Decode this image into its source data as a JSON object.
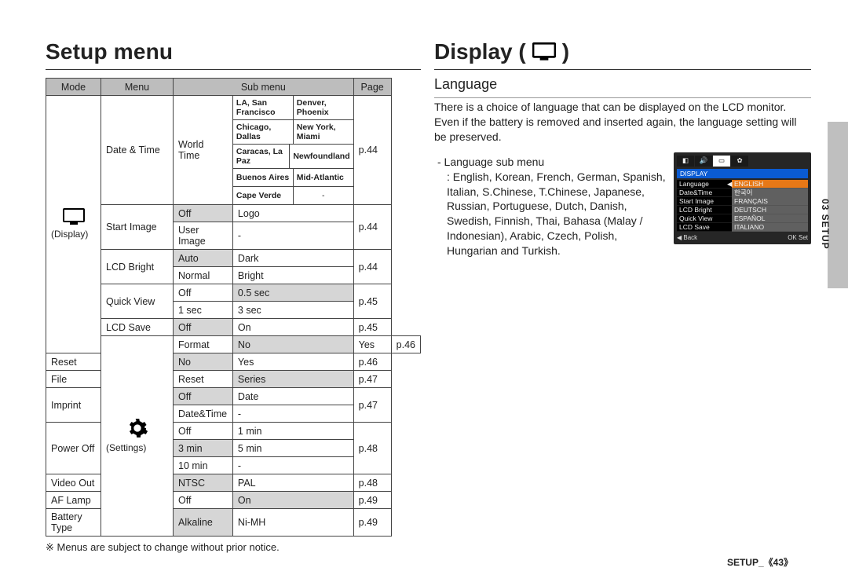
{
  "left": {
    "title": "Setup menu",
    "headers": {
      "mode": "Mode",
      "menu": "Menu",
      "submenu": "Sub menu",
      "page": "Page"
    },
    "display_label": "(Display)",
    "settings_label": "(Settings)",
    "footnote": "※ Menus are subject to change without prior notice.",
    "rows": {
      "datetime": {
        "menu": "Date & Time",
        "sub": "World Time",
        "page": "p.44",
        "cities": [
          [
            "LA, San Francisco",
            "Denver, Phoenix"
          ],
          [
            "Chicago, Dallas",
            "New York, Miami"
          ],
          [
            "Caracas, La Paz",
            "Newfoundland"
          ],
          [
            "Buenos Aires",
            "Mid-Atlantic"
          ],
          [
            "Cape Verde",
            "-"
          ]
        ]
      },
      "startimage": {
        "menu": "Start Image",
        "vals": [
          [
            "Off",
            "Logo"
          ],
          [
            "User Image",
            "-"
          ]
        ],
        "page": "p.44"
      },
      "lcdbright": {
        "menu": "LCD Bright",
        "vals": [
          [
            "Auto",
            "Dark"
          ],
          [
            "Normal",
            "Bright"
          ]
        ],
        "page": "p.44"
      },
      "quickview": {
        "menu": "Quick View",
        "vals": [
          [
            "Off",
            "0.5 sec"
          ],
          [
            "1 sec",
            "3 sec"
          ]
        ],
        "page": "p.45"
      },
      "lcdsave": {
        "menu": "LCD Save",
        "vals": [
          [
            "Off",
            "On"
          ]
        ],
        "page": "p.45"
      },
      "format": {
        "menu": "Format",
        "vals": [
          [
            "No",
            "Yes"
          ]
        ],
        "page": "p.46"
      },
      "reset": {
        "menu": "Reset",
        "vals": [
          [
            "No",
            "Yes"
          ]
        ],
        "page": "p.46"
      },
      "file": {
        "menu": "File",
        "vals": [
          [
            "Reset",
            "Series"
          ]
        ],
        "page": "p.47"
      },
      "imprint": {
        "menu": "Imprint",
        "vals": [
          [
            "Off",
            "Date"
          ],
          [
            "Date&Time",
            "-"
          ]
        ],
        "page": "p.47"
      },
      "poweroff": {
        "menu": "Power Off",
        "vals": [
          [
            "Off",
            "1 min"
          ],
          [
            "3 min",
            "5 min"
          ],
          [
            "10 min",
            "-"
          ]
        ],
        "page": "p.48"
      },
      "videoout": {
        "menu": "Video Out",
        "vals": [
          [
            "NTSC",
            "PAL"
          ]
        ],
        "page": "p.48"
      },
      "aflamp": {
        "menu": "AF Lamp",
        "vals": [
          [
            "Off",
            "On"
          ]
        ],
        "page": "p.49"
      },
      "battery": {
        "menu": "Battery Type",
        "vals": [
          [
            "Alkaline",
            "Ni-MH"
          ]
        ],
        "page": "p.49"
      }
    }
  },
  "right": {
    "title_prefix": "Display (",
    "title_suffix": " )",
    "section": "Language",
    "paragraph": "There is a choice of language that can be displayed on the LCD monitor. Even if the battery is removed and inserted again, the language setting will be preserved.",
    "bullet": "- Language sub menu",
    "bullet_body": ": English, Korean, French, German, Spanish, Italian, S.Chinese, T.Chinese, Japanese, Russian, Portuguese, Dutch, Danish, Swedish, Finnish, Thai, Bahasa (Malay / Indonesian), Arabic, Czech, Polish, Hungarian and Turkish."
  },
  "camera": {
    "header": "DISPLAY",
    "items": [
      {
        "label": "Language",
        "value": "ENGLISH"
      },
      {
        "label": "Date&Time",
        "value": "한국어"
      },
      {
        "label": "Start Image",
        "value": "FRANÇAIS"
      },
      {
        "label": "LCD Bright",
        "value": "DEUTSCH"
      },
      {
        "label": "Quick View",
        "value": "ESPAÑOL"
      },
      {
        "label": "LCD Save",
        "value": "ITALIANO"
      }
    ],
    "footer_back": "◀  Back",
    "footer_set": "OK  Set"
  },
  "side_tab": "03 SETUP",
  "footer": {
    "label": "SETUP_",
    "page": "《43》"
  }
}
